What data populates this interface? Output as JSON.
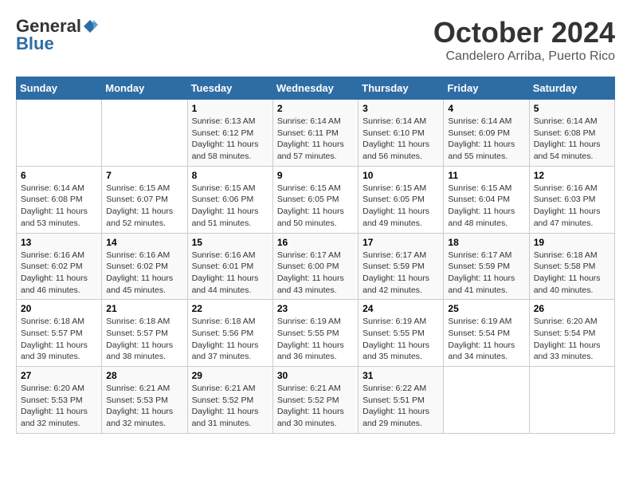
{
  "logo": {
    "general": "General",
    "blue": "Blue"
  },
  "title": "October 2024",
  "subtitle": "Candelero Arriba, Puerto Rico",
  "days_of_week": [
    "Sunday",
    "Monday",
    "Tuesday",
    "Wednesday",
    "Thursday",
    "Friday",
    "Saturday"
  ],
  "weeks": [
    [
      {
        "day": "",
        "sunrise": "",
        "sunset": "",
        "daylight": ""
      },
      {
        "day": "",
        "sunrise": "",
        "sunset": "",
        "daylight": ""
      },
      {
        "day": "1",
        "sunrise": "Sunrise: 6:13 AM",
        "sunset": "Sunset: 6:12 PM",
        "daylight": "Daylight: 11 hours and 58 minutes."
      },
      {
        "day": "2",
        "sunrise": "Sunrise: 6:14 AM",
        "sunset": "Sunset: 6:11 PM",
        "daylight": "Daylight: 11 hours and 57 minutes."
      },
      {
        "day": "3",
        "sunrise": "Sunrise: 6:14 AM",
        "sunset": "Sunset: 6:10 PM",
        "daylight": "Daylight: 11 hours and 56 minutes."
      },
      {
        "day": "4",
        "sunrise": "Sunrise: 6:14 AM",
        "sunset": "Sunset: 6:09 PM",
        "daylight": "Daylight: 11 hours and 55 minutes."
      },
      {
        "day": "5",
        "sunrise": "Sunrise: 6:14 AM",
        "sunset": "Sunset: 6:08 PM",
        "daylight": "Daylight: 11 hours and 54 minutes."
      }
    ],
    [
      {
        "day": "6",
        "sunrise": "Sunrise: 6:14 AM",
        "sunset": "Sunset: 6:08 PM",
        "daylight": "Daylight: 11 hours and 53 minutes."
      },
      {
        "day": "7",
        "sunrise": "Sunrise: 6:15 AM",
        "sunset": "Sunset: 6:07 PM",
        "daylight": "Daylight: 11 hours and 52 minutes."
      },
      {
        "day": "8",
        "sunrise": "Sunrise: 6:15 AM",
        "sunset": "Sunset: 6:06 PM",
        "daylight": "Daylight: 11 hours and 51 minutes."
      },
      {
        "day": "9",
        "sunrise": "Sunrise: 6:15 AM",
        "sunset": "Sunset: 6:05 PM",
        "daylight": "Daylight: 11 hours and 50 minutes."
      },
      {
        "day": "10",
        "sunrise": "Sunrise: 6:15 AM",
        "sunset": "Sunset: 6:05 PM",
        "daylight": "Daylight: 11 hours and 49 minutes."
      },
      {
        "day": "11",
        "sunrise": "Sunrise: 6:15 AM",
        "sunset": "Sunset: 6:04 PM",
        "daylight": "Daylight: 11 hours and 48 minutes."
      },
      {
        "day": "12",
        "sunrise": "Sunrise: 6:16 AM",
        "sunset": "Sunset: 6:03 PM",
        "daylight": "Daylight: 11 hours and 47 minutes."
      }
    ],
    [
      {
        "day": "13",
        "sunrise": "Sunrise: 6:16 AM",
        "sunset": "Sunset: 6:02 PM",
        "daylight": "Daylight: 11 hours and 46 minutes."
      },
      {
        "day": "14",
        "sunrise": "Sunrise: 6:16 AM",
        "sunset": "Sunset: 6:02 PM",
        "daylight": "Daylight: 11 hours and 45 minutes."
      },
      {
        "day": "15",
        "sunrise": "Sunrise: 6:16 AM",
        "sunset": "Sunset: 6:01 PM",
        "daylight": "Daylight: 11 hours and 44 minutes."
      },
      {
        "day": "16",
        "sunrise": "Sunrise: 6:17 AM",
        "sunset": "Sunset: 6:00 PM",
        "daylight": "Daylight: 11 hours and 43 minutes."
      },
      {
        "day": "17",
        "sunrise": "Sunrise: 6:17 AM",
        "sunset": "Sunset: 5:59 PM",
        "daylight": "Daylight: 11 hours and 42 minutes."
      },
      {
        "day": "18",
        "sunrise": "Sunrise: 6:17 AM",
        "sunset": "Sunset: 5:59 PM",
        "daylight": "Daylight: 11 hours and 41 minutes."
      },
      {
        "day": "19",
        "sunrise": "Sunrise: 6:18 AM",
        "sunset": "Sunset: 5:58 PM",
        "daylight": "Daylight: 11 hours and 40 minutes."
      }
    ],
    [
      {
        "day": "20",
        "sunrise": "Sunrise: 6:18 AM",
        "sunset": "Sunset: 5:57 PM",
        "daylight": "Daylight: 11 hours and 39 minutes."
      },
      {
        "day": "21",
        "sunrise": "Sunrise: 6:18 AM",
        "sunset": "Sunset: 5:57 PM",
        "daylight": "Daylight: 11 hours and 38 minutes."
      },
      {
        "day": "22",
        "sunrise": "Sunrise: 6:18 AM",
        "sunset": "Sunset: 5:56 PM",
        "daylight": "Daylight: 11 hours and 37 minutes."
      },
      {
        "day": "23",
        "sunrise": "Sunrise: 6:19 AM",
        "sunset": "Sunset: 5:55 PM",
        "daylight": "Daylight: 11 hours and 36 minutes."
      },
      {
        "day": "24",
        "sunrise": "Sunrise: 6:19 AM",
        "sunset": "Sunset: 5:55 PM",
        "daylight": "Daylight: 11 hours and 35 minutes."
      },
      {
        "day": "25",
        "sunrise": "Sunrise: 6:19 AM",
        "sunset": "Sunset: 5:54 PM",
        "daylight": "Daylight: 11 hours and 34 minutes."
      },
      {
        "day": "26",
        "sunrise": "Sunrise: 6:20 AM",
        "sunset": "Sunset: 5:54 PM",
        "daylight": "Daylight: 11 hours and 33 minutes."
      }
    ],
    [
      {
        "day": "27",
        "sunrise": "Sunrise: 6:20 AM",
        "sunset": "Sunset: 5:53 PM",
        "daylight": "Daylight: 11 hours and 32 minutes."
      },
      {
        "day": "28",
        "sunrise": "Sunrise: 6:21 AM",
        "sunset": "Sunset: 5:53 PM",
        "daylight": "Daylight: 11 hours and 32 minutes."
      },
      {
        "day": "29",
        "sunrise": "Sunrise: 6:21 AM",
        "sunset": "Sunset: 5:52 PM",
        "daylight": "Daylight: 11 hours and 31 minutes."
      },
      {
        "day": "30",
        "sunrise": "Sunrise: 6:21 AM",
        "sunset": "Sunset: 5:52 PM",
        "daylight": "Daylight: 11 hours and 30 minutes."
      },
      {
        "day": "31",
        "sunrise": "Sunrise: 6:22 AM",
        "sunset": "Sunset: 5:51 PM",
        "daylight": "Daylight: 11 hours and 29 minutes."
      },
      {
        "day": "",
        "sunrise": "",
        "sunset": "",
        "daylight": ""
      },
      {
        "day": "",
        "sunrise": "",
        "sunset": "",
        "daylight": ""
      }
    ]
  ]
}
